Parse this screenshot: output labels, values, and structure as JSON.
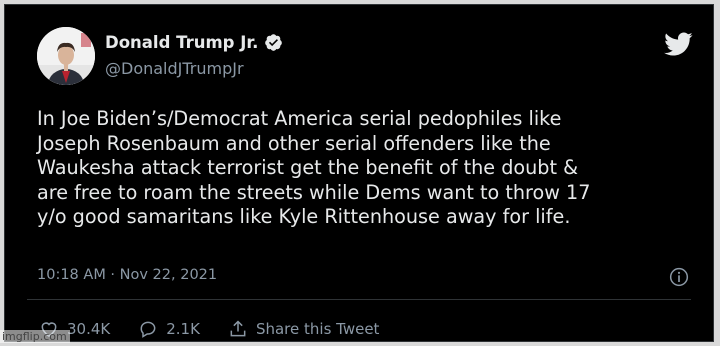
{
  "author": {
    "display_name": "Donald Trump Jr.",
    "handle": "@DonaldJTrumpJr"
  },
  "tweet": {
    "text": "In Joe Biden’s/Democrat America serial pedophiles like\nJoseph Rosenbaum and other serial offenders like the\nWaukesha attack terrorist get the benefit of the doubt &\nare free to roam the streets while Dems want to throw 17\ny/o good samaritans like Kyle Rittenhouse away for life.",
    "time": "10:18 AM · Nov 22, 2021"
  },
  "actions": {
    "likes": "30.4K",
    "replies": "2.1K",
    "share_label": "Share this Tweet"
  },
  "icons": [
    "verified-badge-icon",
    "twitter-bird-icon",
    "info-icon",
    "heart-icon",
    "reply-icon",
    "share-icon"
  ],
  "colors": {
    "background": "#000000",
    "text_primary": "#e7e9ea",
    "text_secondary": "#8b98a5",
    "twitter_blue": "#1d9bf0"
  },
  "watermark": "imgflip.com"
}
